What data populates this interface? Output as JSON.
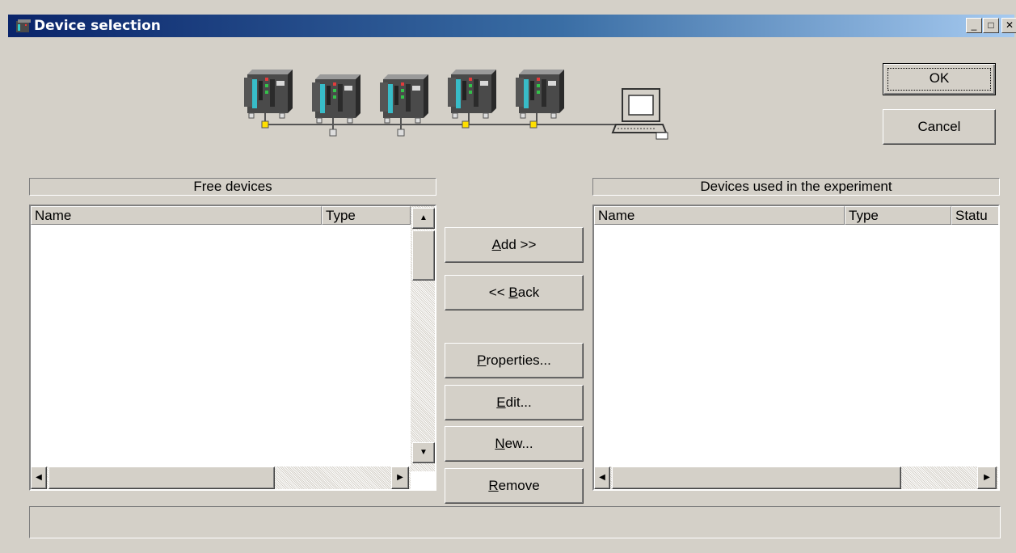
{
  "window": {
    "title": "Device selection",
    "minimize_glyph": "_",
    "maximize_glyph": "□",
    "close_glyph": "✕"
  },
  "dialog_buttons": {
    "ok": "OK",
    "cancel": "Cancel"
  },
  "free_devices": {
    "header": "Free devices",
    "columns": [
      "Name",
      "Type"
    ],
    "rows": []
  },
  "used_devices": {
    "header": "Devices used in the experiment",
    "columns": [
      "Name",
      "Type",
      "Statu"
    ],
    "rows": []
  },
  "actions": {
    "add": {
      "pre": "",
      "mnemonic": "A",
      "post": "dd  >>"
    },
    "back": {
      "pre": "<< ",
      "mnemonic": "B",
      "post": "ack"
    },
    "properties": {
      "pre": "",
      "mnemonic": "P",
      "post": "roperties..."
    },
    "edit": {
      "pre": "",
      "mnemonic": "E",
      "post": "dit..."
    },
    "new": {
      "pre": "",
      "mnemonic": "N",
      "post": "ew..."
    },
    "remove": {
      "pre": "",
      "mnemonic": "R",
      "post": "emove"
    }
  },
  "status_text": "",
  "colors": {
    "face": "#d4d0c8",
    "title_start": "#0a246a",
    "title_end": "#a6caf0"
  }
}
